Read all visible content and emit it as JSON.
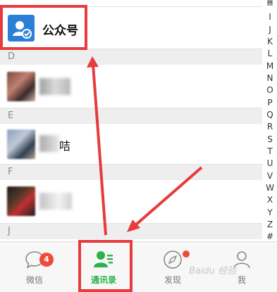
{
  "contacts": {
    "official_account_label": "公众号",
    "sections": [
      "D",
      "E",
      "F",
      "J"
    ],
    "partial_name_chars": [
      "\u001f",
      "咭"
    ]
  },
  "index_bar": [
    "I",
    "H",
    "J",
    "K",
    "L",
    "M",
    "N",
    "O",
    "P",
    "Q",
    "R",
    "S",
    "T",
    "U",
    "V",
    "W",
    "X",
    "Y",
    "Z",
    "#"
  ],
  "tabs": [
    {
      "label": "微信",
      "icon": "chat-bubble-icon",
      "badge": "4"
    },
    {
      "label": "通讯录",
      "icon": "contacts-icon",
      "active": true
    },
    {
      "label": "发现",
      "icon": "compass-icon",
      "dot": true
    },
    {
      "label": "我",
      "icon": "person-icon"
    }
  ],
  "watermark": "Baidu 经验",
  "colors": {
    "highlight": "#e83b3b",
    "active_green": "#2cb24a",
    "badge_red": "#f04a3a",
    "official_blue": "#2b7fd6"
  }
}
